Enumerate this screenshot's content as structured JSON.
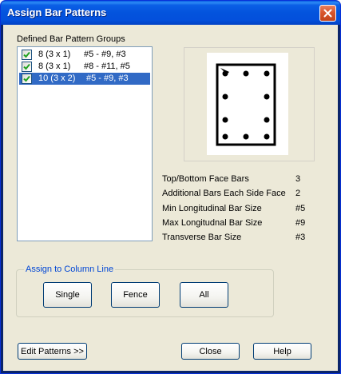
{
  "window": {
    "title": "Assign Bar Patterns"
  },
  "groups": {
    "label": "Defined Bar Pattern Groups",
    "items": [
      {
        "pattern": "8 (3 x 1)",
        "bars": "#5 - #9, #3",
        "checked": true,
        "selected": false
      },
      {
        "pattern": "8 (3 x 1)",
        "bars": "#8 - #11, #5",
        "checked": true,
        "selected": false
      },
      {
        "pattern": "10 (3 x 2)",
        "bars": "#5 - #9, #3",
        "checked": true,
        "selected": true
      }
    ]
  },
  "properties": [
    {
      "label": "Top/Bottom Face Bars",
      "value": "3"
    },
    {
      "label": "Additional Bars Each Side Face",
      "value": "2"
    },
    {
      "label": "Min Longitudinal Bar Size",
      "value": "#5"
    },
    {
      "label": "Max Longitudnal Bar Size",
      "value": "#9"
    },
    {
      "label": "Transverse Bar Size",
      "value": "#3"
    }
  ],
  "assign": {
    "legend": "Assign to Column Line",
    "single_label": "Single",
    "fence_label": "Fence",
    "all_label": "All"
  },
  "footer": {
    "edit_label": "Edit Patterns >>",
    "close_label": "Close",
    "help_label": "Help"
  },
  "colors": {
    "titlebar": "#0353dd",
    "selection": "#316ac5",
    "dialog_bg": "#ece9d8",
    "group_legend": "#0046d5",
    "close_button": "#d9562c"
  },
  "icons": {
    "close": "close-icon",
    "check": "checkmark-icon"
  }
}
